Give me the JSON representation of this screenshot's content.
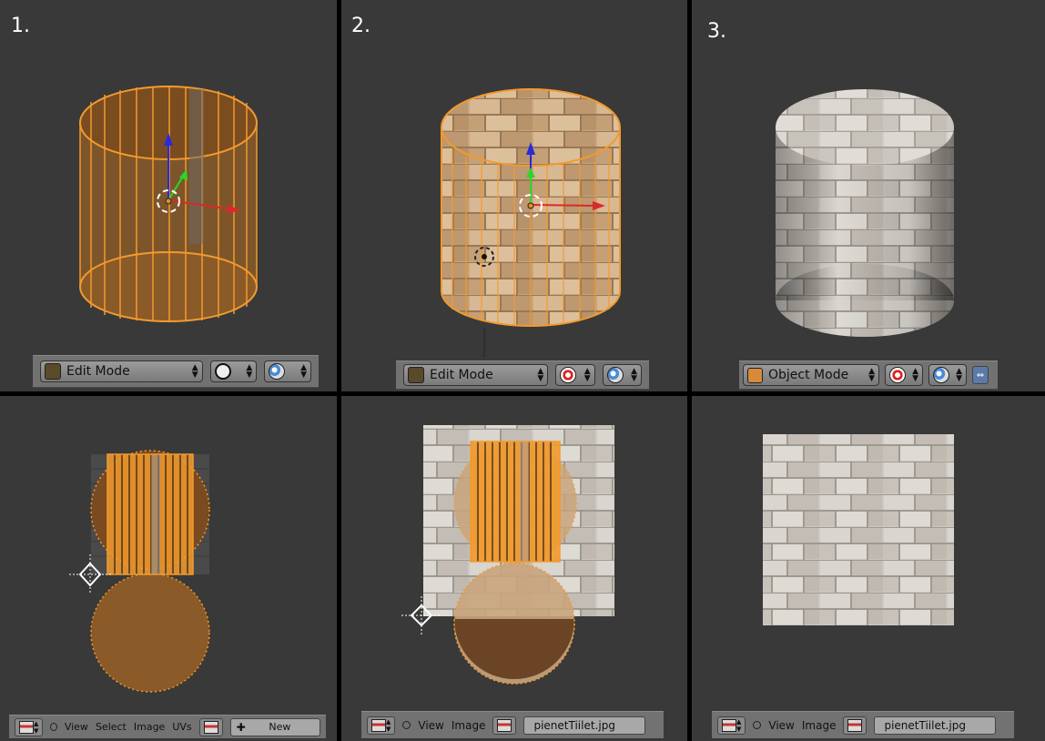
{
  "panels": {
    "p1": {
      "step": "1.",
      "mode": "Edit Mode"
    },
    "p2": {
      "step": "2.",
      "mode": "Edit Mode"
    },
    "p3": {
      "step": "3.",
      "mode": "Object Mode"
    }
  },
  "uv": {
    "p4": {
      "menu": [
        "View",
        "Select",
        "Image",
        "UVs"
      ],
      "new_label": "New"
    },
    "p5": {
      "menu": [
        "View",
        "Image"
      ],
      "image_name": "pienetTiilet.jpg"
    },
    "p6": {
      "menu": [
        "View",
        "Image"
      ],
      "image_name": "pienetTiilet.jpg"
    }
  },
  "colors": {
    "panel_bg": "#393939",
    "selected_orange": "#f29a2e",
    "mesh_fill": "#8a5a28",
    "brick_light": "#d8d3cc",
    "header_bg": "#727272"
  },
  "icons": [
    "edit-mode-icon",
    "object-mode-icon",
    "viewport-shading-icon",
    "proportional-editing-icon",
    "pivot-icon",
    "image-editor-icon",
    "image-icon"
  ]
}
